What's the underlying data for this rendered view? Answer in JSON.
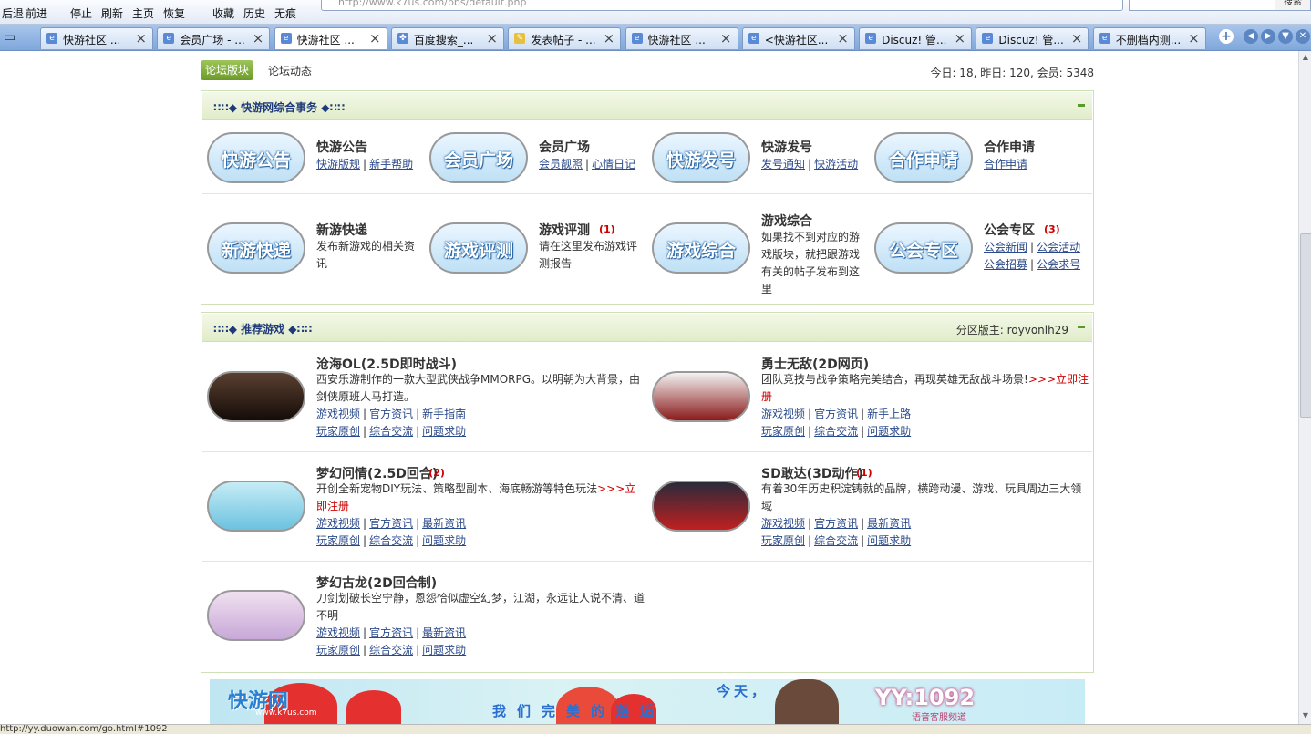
{
  "browser": {
    "toolbar": [
      "后退",
      "前进",
      "停止",
      "刷新",
      "主页",
      "恢复",
      "收藏",
      "历史",
      "无痕"
    ],
    "address": "http://www.k7us.com/bbs/default.php",
    "search_placeholder": "搜索",
    "search_button": "搜索",
    "tabs": [
      {
        "label": "快游社区 ...",
        "icon": "page-icon",
        "active": false
      },
      {
        "label": "会员广场 - ...",
        "icon": "page-icon",
        "active": false
      },
      {
        "label": "快游社区 ...",
        "icon": "page-icon",
        "active": true
      },
      {
        "label": "百度搜索_...",
        "icon": "baidu-paw-icon",
        "active": false
      },
      {
        "label": "发表帖子 - ...",
        "icon": "note-icon",
        "active": false
      },
      {
        "label": "快游社区 ...",
        "icon": "page-icon",
        "active": false
      },
      {
        "label": "<快游社区...",
        "icon": "page-icon",
        "active": false
      },
      {
        "label": "Discuz! 管...",
        "icon": "page-icon",
        "active": false
      },
      {
        "label": "Discuz! 管...",
        "icon": "page-icon",
        "active": false
      },
      {
        "label": "不删档内测...",
        "icon": "page-icon",
        "active": false
      }
    ],
    "status_text": "http://yy.duowan.com/go.html#1092"
  },
  "page": {
    "nav_forum": "论坛版块",
    "nav_dynamic": "论坛动态",
    "stats": "今日: 18, 昨日: 120, 会员: 5348"
  },
  "section1": {
    "title": "∷∷◆ 快游网综合事务 ◆∷∷",
    "forums": [
      {
        "logo": "快游公告",
        "name": "快游公告",
        "links": [
          "快游版规",
          "新手帮助"
        ]
      },
      {
        "logo": "会员广场",
        "name": "会员广场",
        "links": [
          "会员靓照",
          "心情日记"
        ]
      },
      {
        "logo": "快游发号",
        "name": "快游发号",
        "links": [
          "发号通知",
          "快游活动"
        ]
      },
      {
        "logo": "合作申请",
        "name": "合作申请",
        "links": [
          "合作申请"
        ]
      },
      {
        "logo": "新游快递",
        "name": "新游快递",
        "desc": "发布新游戏的相关资讯"
      },
      {
        "logo": "游戏评测",
        "name": "游戏评测",
        "badge": "(1)",
        "desc": "请在这里发布游戏评测报告"
      },
      {
        "logo": "游戏综合",
        "name": "游戏综合",
        "desc": "如果找不到对应的游戏版块，就把跟游戏有关的帖子发布到这里"
      },
      {
        "logo": "公会专区",
        "name": "公会专区",
        "badge": "(3)",
        "links": [
          "公会新闻",
          "公会活动",
          "公会招募",
          "公会求号"
        ]
      }
    ]
  },
  "section2": {
    "title": "∷∷◆ 推荐游戏 ◆∷∷",
    "moderator": "分区版主: royvonlh29",
    "games": [
      {
        "name": "沧海OL(2.5D即时战斗)",
        "desc": "西安乐游制作的一款大型武侠战争MMORPG。以明朝为大背景，由剑侠原班人马打造。",
        "links": [
          "游戏视频",
          "官方资讯",
          "新手指南",
          "玩家原创",
          "综合交流",
          "问题求助"
        ]
      },
      {
        "name": "勇士无敌(2D网页)",
        "desc": "团队竞技与战争策略完美结合，再现英雄无敌战斗场景!",
        "reg": ">>>立即注册",
        "links": [
          "游戏视频",
          "官方资讯",
          "新手上路",
          "玩家原创",
          "综合交流",
          "问题求助"
        ]
      },
      {
        "name": "梦幻问情(2.5D回合)",
        "badge": "(2)",
        "desc": "开创全新宠物DIY玩法、策略型副本、海底畅游等特色玩法",
        "reg": ">>>立即注册",
        "links": [
          "游戏视频",
          "官方资讯",
          "最新资讯",
          "玩家原创",
          "综合交流",
          "问题求助"
        ]
      },
      {
        "name": "SD敢达(3D动作)",
        "badge": "(1)",
        "desc": "有着30年历史积淀铸就的品牌，横跨动漫、游戏、玩具周边三大领域",
        "links": [
          "游戏视频",
          "官方资讯",
          "最新资讯",
          "玩家原创",
          "综合交流",
          "问题求助"
        ]
      },
      {
        "name": "梦幻古龙(2D回合制)",
        "desc": "刀剑划破长空宁静，恩怨恰似虚空幻梦，江湖，永远让人说不清、道不明",
        "links": [
          "游戏视频",
          "官方资讯",
          "最新资讯",
          "玩家原创",
          "综合交流",
          "问题求助"
        ]
      }
    ]
  },
  "banner": {
    "logo": "快游网",
    "logo_sub": "www.k7us.com",
    "line1": "今天，",
    "line2": "我们完美的邂逅",
    "yy": "YY:1092",
    "yy_sub": "语音客服频道"
  }
}
